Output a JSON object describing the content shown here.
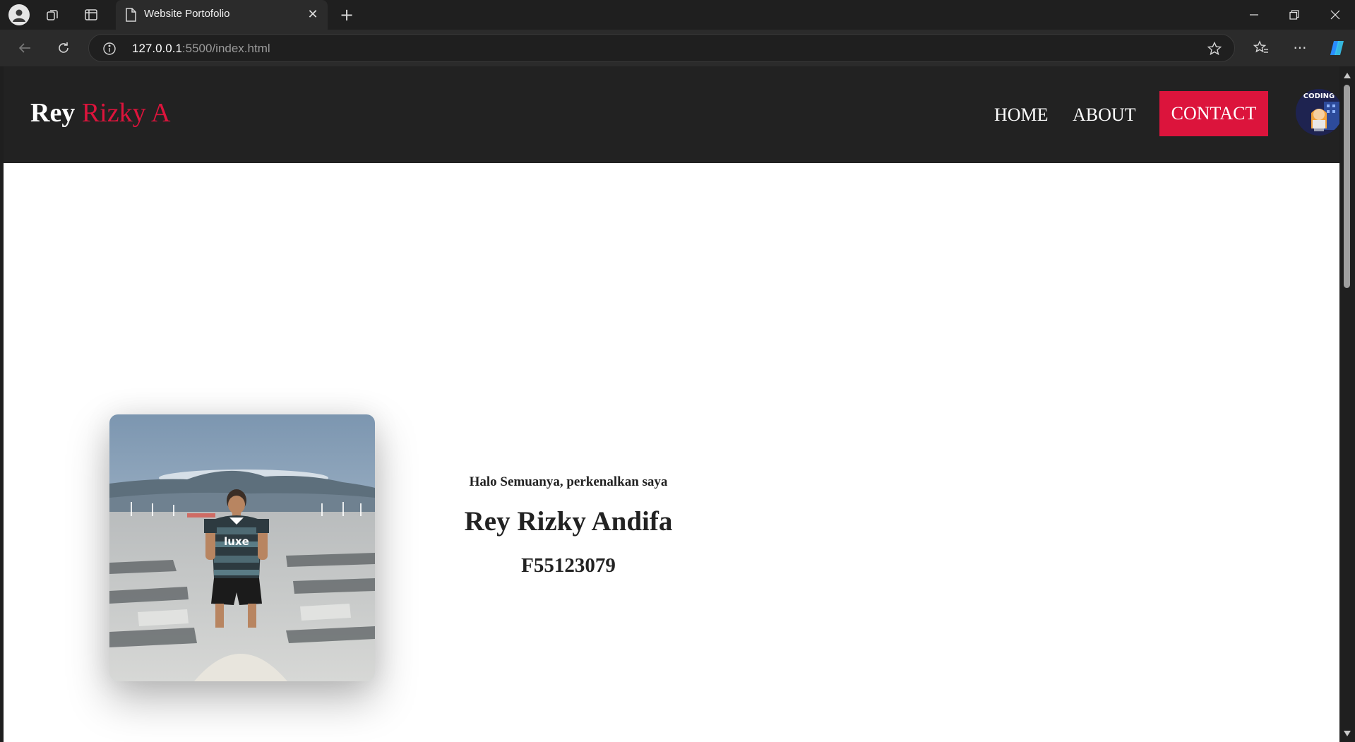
{
  "browser": {
    "tab_title": "Website Portofolio",
    "url_host": "127.0.0.1",
    "url_rest": ":5500/index.html"
  },
  "site": {
    "logo_first": "Rey",
    "logo_rest": "Rizky A",
    "nav": {
      "home": "HOME",
      "about": "ABOUT",
      "contact": "CONTACT"
    },
    "avatar_text": "CODING",
    "hero": {
      "greeting": "Halo Semuanya, perkenalkan saya",
      "name": "Rey Rizky Andifa",
      "id": "F55123079"
    },
    "shirt_text": "luxe"
  },
  "colors": {
    "accent": "#dc143c",
    "header_bg": "#222222",
    "page_bg": "#ffffff"
  },
  "icons": [
    "profile-icon",
    "workspaces-icon",
    "tab-actions-icon",
    "page-icon",
    "close-icon",
    "new-tab-icon",
    "minimize-icon",
    "restore-icon",
    "close-window-icon",
    "back-icon",
    "reload-icon",
    "site-info-icon",
    "favorite-star-icon",
    "favorites-icon",
    "more-icon",
    "copilot-icon"
  ]
}
